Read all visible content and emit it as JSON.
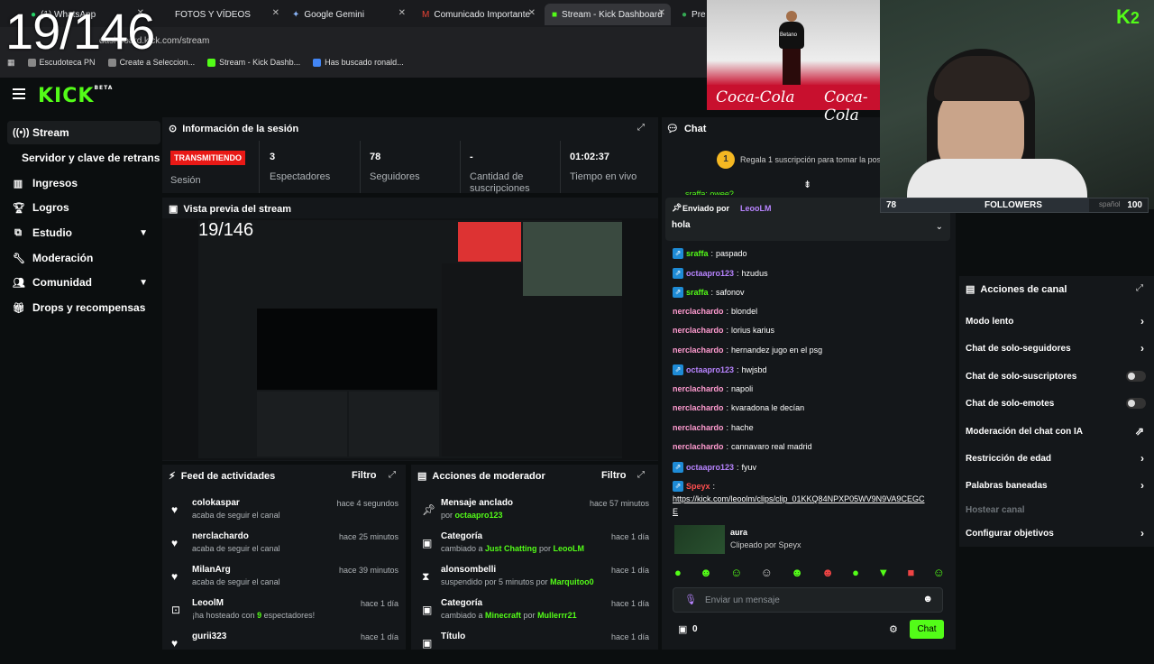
{
  "counter": "19/146",
  "browser": {
    "tabs": [
      {
        "label": "(1) WhatsApp"
      },
      {
        "label": "FOTOS Y VÍDEOS"
      },
      {
        "label": "Google Gemini"
      },
      {
        "label": "Comunicado Importante"
      },
      {
        "label": "Stream - Kick Dashboard"
      },
      {
        "label": "Pre"
      }
    ],
    "address": "dashboard.kick.com/stream",
    "bookmarks": [
      "Escudoteca PN",
      "Create a Seleccion...",
      "Stream - Kick Dashb...",
      "Has buscado ronald..."
    ]
  },
  "kick": {
    "logo": "KICK",
    "beta": "BETA"
  },
  "sidebar": {
    "items": [
      {
        "label": "Stream"
      },
      {
        "label": "Servidor y clave de retransmisión"
      },
      {
        "label": "Ingresos"
      },
      {
        "label": "Logros"
      },
      {
        "label": "Estudio"
      },
      {
        "label": "Moderación"
      },
      {
        "label": "Comunidad"
      },
      {
        "label": "Drops y recompensas"
      }
    ]
  },
  "session": {
    "title": "Información de la sesión",
    "status": "TRANSMITIENDO",
    "status_label": "Sesión",
    "viewers": "3",
    "viewers_label": "Espectadores",
    "followers": "78",
    "followers_label": "Seguidores",
    "subs": "-",
    "subs_label": "Cantidad de suscripciones",
    "uptime": "01:02:37",
    "uptime_label": "Tiempo en vivo"
  },
  "preview": {
    "title": "Vista previa del stream",
    "counter": "19/146"
  },
  "feed": {
    "title": "Feed de actividades",
    "filter": "Filtro",
    "items": [
      {
        "name": "colokaspar",
        "sub": "acaba de seguir el canal",
        "time": "hace 4 segundos"
      },
      {
        "name": "nerclachardo",
        "sub": "acaba de seguir el canal",
        "time": "hace 25 minutos"
      },
      {
        "name": "MilanArg",
        "sub": "acaba de seguir el canal",
        "time": "hace 39 minutos"
      },
      {
        "name": "LeoolM",
        "sub_a": "¡ha hosteado con ",
        "sub_b": "9",
        "sub_c": " espectadores!",
        "time": "hace 1 día"
      },
      {
        "name": "gurii323",
        "time": "hace 1 día"
      }
    ]
  },
  "modactions": {
    "title": "Acciones de moderador",
    "filter": "Filtro",
    "items": [
      {
        "name": "Mensaje anclado",
        "sub_a": "por ",
        "sub_b": "octaapro123",
        "time": "hace 57 minutos"
      },
      {
        "name": "Categoría",
        "sub_a": "cambiado a ",
        "sub_b": "Just Chatting",
        "sub_c": " por ",
        "sub_d": "LeooLM",
        "time": "hace 1 día"
      },
      {
        "name": "alonsombelli",
        "sub_a": "suspendido por 5 minutos por ",
        "sub_b": "Marquitoo0",
        "time": "hace 1 día"
      },
      {
        "name": "Categoría",
        "sub_a": "cambiado a ",
        "sub_b": "Minecraft",
        "sub_c": " por ",
        "sub_d": "Mullerrr21",
        "time": "hace 1 día"
      },
      {
        "name": "Título",
        "time": "hace 1 día"
      }
    ]
  },
  "chat": {
    "title": "Chat",
    "gift": "Regala 1 suscripción para tomar la pos",
    "gift_count": "1",
    "pinned_by": "Enviado por",
    "pinned_user": "LeooLM",
    "pinned_msg": "hola",
    "partial_top": "sraffa: owee?",
    "messages": [
      {
        "user": "sraffa",
        "text": "paspado",
        "badge": true,
        "color": "green"
      },
      {
        "user": "octaapro123",
        "text": "hzudus",
        "badge": true,
        "color": "purple"
      },
      {
        "user": "sraffa",
        "text": "safonov",
        "badge": true,
        "color": "green"
      },
      {
        "user": "nerclachardo",
        "text": "blondel",
        "badge": false,
        "color": "pink"
      },
      {
        "user": "nerclachardo",
        "text": "lorius karius",
        "badge": false,
        "color": "pink"
      },
      {
        "user": "nerclachardo",
        "text": "hernandez jugo en el psg",
        "badge": false,
        "color": "pink"
      },
      {
        "user": "octaapro123",
        "text": "hwjsbd",
        "badge": true,
        "color": "purple"
      },
      {
        "user": "nerclachardo",
        "text": "napoli",
        "badge": false,
        "color": "pink"
      },
      {
        "user": "nerclachardo",
        "text": "kvaradona le decían",
        "badge": false,
        "color": "pink"
      },
      {
        "user": "nerclachardo",
        "text": "hache",
        "badge": false,
        "color": "pink"
      },
      {
        "user": "nerclachardo",
        "text": "cannavaro real madrid",
        "badge": false,
        "color": "pink"
      },
      {
        "user": "octaapro123",
        "text": "fyuv",
        "badge": true,
        "color": "purple"
      },
      {
        "user": "Speyx",
        "text": "",
        "badge": true,
        "color": "red"
      }
    ],
    "link": "https://kick.com/leoolm/clips/clip_01KKQ84NPXP05WV9N9VA9CEGC",
    "link_tail": "E",
    "clip_title": "aura",
    "clip_sub": "Clipeado por Speyx",
    "placeholder": "Enviar un mensaje",
    "count": "0",
    "send": "Chat"
  },
  "channel": {
    "title": "Acciones de canal",
    "items": [
      {
        "label": "Modo lento",
        "kind": "arrow"
      },
      {
        "label": "Chat de solo-seguidores",
        "kind": "arrow"
      },
      {
        "label": "Chat de solo-suscriptores",
        "kind": "toggle"
      },
      {
        "label": "Chat de solo-emotes",
        "kind": "toggle"
      },
      {
        "label": "Moderación del chat con IA",
        "kind": "external"
      },
      {
        "label": "Restricción de edad",
        "kind": "arrow"
      },
      {
        "label": "Palabras baneadas",
        "kind": "arrow"
      },
      {
        "label": "Hostear canal",
        "kind": "disabled"
      },
      {
        "label": "Configurar objetivos",
        "kind": "arrow"
      }
    ]
  },
  "overlay": {
    "followers_count": "78",
    "followers_label": "FOLLOWERS",
    "followers_goal": "100",
    "kick_logo": "K",
    "kick_count": "2",
    "lang_tail": "spañol",
    "sponsor": "Coca-Cola",
    "jersey": "Betano"
  },
  "colors": {
    "accent": "#53fc18",
    "live": "#e91916",
    "panel": "#14171a"
  }
}
